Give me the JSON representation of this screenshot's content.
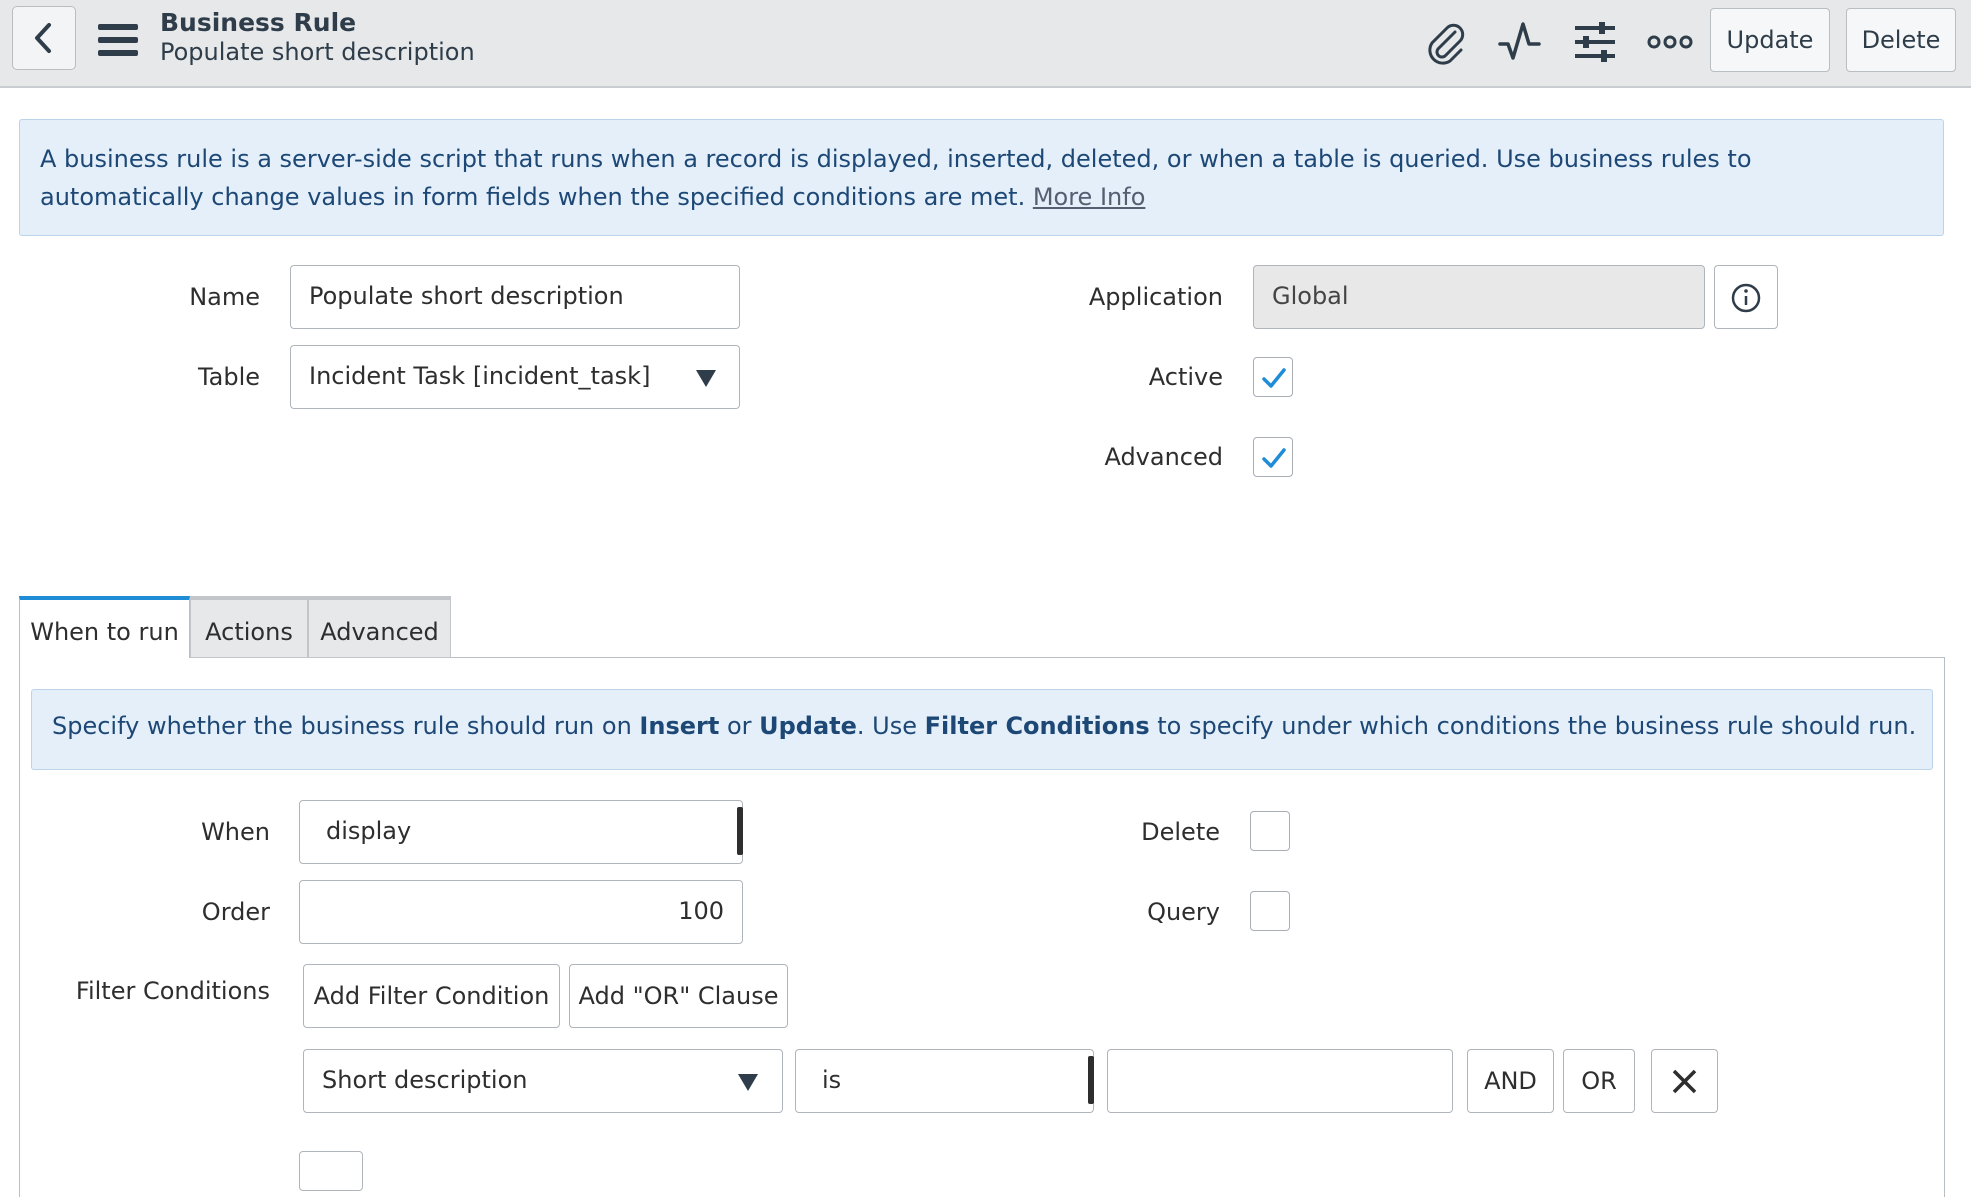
{
  "header": {
    "title": "Business Rule",
    "subtitle": "Populate short description",
    "icons": [
      "back-icon",
      "menu-icon",
      "attachment-icon",
      "activity-icon",
      "settings-icon",
      "more-icon"
    ],
    "update_label": "Update",
    "delete_label": "Delete"
  },
  "info_banner": {
    "text": "A business rule is a server-side script that runs when a record is displayed, inserted, deleted, or when a table is queried. Use business rules to automatically change values in form fields when the specified conditions are met. ",
    "link": "More Info"
  },
  "form": {
    "name_label": "Name",
    "name_value": "Populate short description",
    "table_label": "Table",
    "table_value": "Incident Task [incident_task]",
    "application_label": "Application",
    "application_value": "Global",
    "active_label": "Active",
    "active_checked": true,
    "advanced_label": "Advanced",
    "advanced_checked": true
  },
  "tabs": [
    {
      "label": "When to run",
      "active": true
    },
    {
      "label": "Actions",
      "active": false
    },
    {
      "label": "Advanced",
      "active": false
    }
  ],
  "when_to_run": {
    "info_prefix": "Specify whether the business rule should run on ",
    "info_insert": "Insert",
    "info_or": " or ",
    "info_update": "Update",
    "info_mid": ". Use ",
    "info_filter": "Filter Conditions",
    "info_suffix": " to specify under which conditions the business rule should run.",
    "when_label": "When",
    "when_value": "display",
    "order_label": "Order",
    "order_value": "100",
    "delete_label": "Delete",
    "delete_checked": false,
    "query_label": "Query",
    "query_checked": false,
    "filter_label": "Filter Conditions",
    "add_filter_label": "Add Filter Condition",
    "add_or_label": "Add \"OR\" Clause",
    "condition": {
      "field": "Short description",
      "operator": "is",
      "value": "",
      "and_label": "AND",
      "or_label": "OR"
    }
  },
  "colors": {
    "accent": "#1f8dd6",
    "header_bg": "#e6e8ea",
    "info_bg": "#e4effa",
    "info_text": "#1d4876"
  }
}
